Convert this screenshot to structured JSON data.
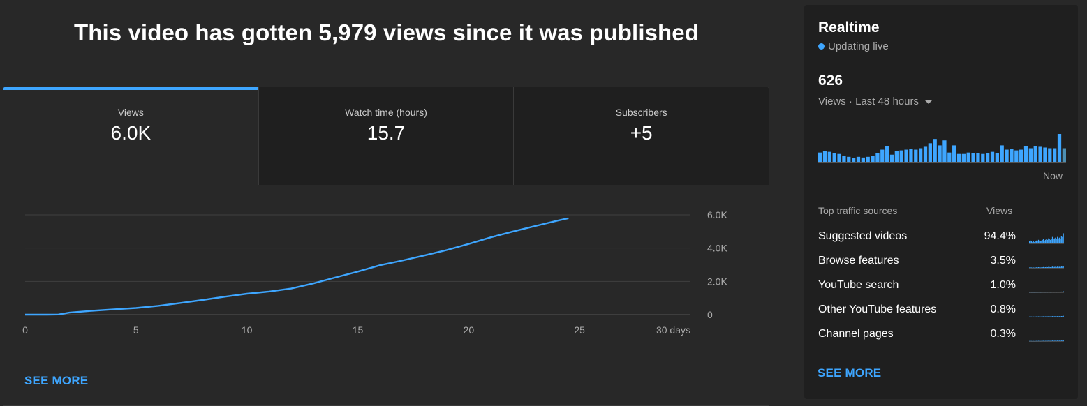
{
  "headline": "This video has gotten 5,979 views since it was published",
  "tabs": [
    {
      "label": "Views",
      "value": "6.0K",
      "active": true
    },
    {
      "label": "Watch time (hours)",
      "value": "15.7",
      "active": false
    },
    {
      "label": "Subscribers",
      "value": "+5",
      "active": false
    }
  ],
  "main_see_more": "SEE MORE",
  "chart_data": {
    "type": "line",
    "series": [
      {
        "color": "#3ea6ff",
        "x": [
          0,
          1,
          1.5,
          2,
          3,
          4,
          5,
          6,
          7,
          8,
          9,
          10,
          11,
          12,
          13,
          14,
          15,
          16,
          17,
          18,
          19,
          20,
          21,
          22,
          23,
          24,
          24.5
        ],
        "values": [
          0,
          0,
          10,
          120,
          230,
          320,
          400,
          530,
          700,
          880,
          1080,
          1260,
          1390,
          1570,
          1880,
          2240,
          2590,
          2970,
          3250,
          3560,
          3880,
          4250,
          4650,
          5000,
          5330,
          5650,
          5800
        ]
      }
    ],
    "x_ticks": [
      "0",
      "5",
      "10",
      "15",
      "20",
      "25",
      "30 days"
    ],
    "x_tick_values": [
      0,
      5,
      10,
      15,
      20,
      25,
      30
    ],
    "y_ticks": [
      "0",
      "2.0K",
      "4.0K",
      "6.0K"
    ],
    "y_tick_values": [
      0,
      2000,
      4000,
      6000
    ],
    "xlim": [
      0,
      30
    ],
    "ylim": [
      0,
      6000
    ],
    "grid": true
  },
  "realtime": {
    "title": "Realtime",
    "status": "Updating live",
    "count": "626",
    "period": "Views · Last 48 hours",
    "now_label": "Now",
    "bars": [
      13,
      15,
      14,
      12,
      11,
      8,
      7,
      5,
      7,
      6,
      7,
      8,
      12,
      17,
      22,
      10,
      15,
      16,
      17,
      18,
      17,
      19,
      21,
      26,
      32,
      23,
      30,
      13,
      23,
      11,
      11,
      13,
      12,
      12,
      11,
      12,
      14,
      12,
      23,
      17,
      18,
      16,
      17,
      22,
      19,
      22,
      21,
      20,
      19,
      19,
      39,
      19
    ],
    "bar_color": "#3ea6ff",
    "last_bar_color": "#4d8fb3"
  },
  "traffic": {
    "header_label": "Top traffic sources",
    "header_views": "Views",
    "sources": [
      {
        "name": "Suggested videos",
        "pct": "94.4%",
        "share": 94.4
      },
      {
        "name": "Browse features",
        "pct": "3.5%",
        "share": 3.5
      },
      {
        "name": "YouTube search",
        "pct": "1.0%",
        "share": 1.0
      },
      {
        "name": "Other YouTube features",
        "pct": "0.8%",
        "share": 0.8
      },
      {
        "name": "Channel pages",
        "pct": "0.3%",
        "share": 0.3
      }
    ],
    "see_more": "SEE MORE"
  },
  "colors": {
    "background": "#282828",
    "card": "#1f1f1f",
    "accent": "#3ea6ff",
    "text": "#ffffff",
    "muted": "#aaaaaa",
    "grid": "#3f3f3f"
  }
}
